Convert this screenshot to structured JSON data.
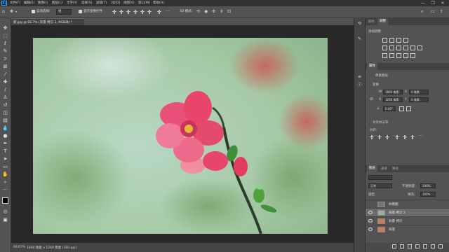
{
  "menubar": {
    "app_icon": "Ps",
    "items": [
      "文件(F)",
      "编辑(E)",
      "图像(I)",
      "图层(L)",
      "文字(Y)",
      "选择(S)",
      "滤镜(T)",
      "3D(D)",
      "视图(V)",
      "窗口(W)",
      "帮助(H)"
    ],
    "window_controls": [
      "—",
      "❐",
      "✕"
    ]
  },
  "options": {
    "auto_select_label": "自动选择:",
    "auto_select_value": "组",
    "transform_label": "显示变换控件",
    "mode_3d_label": "3D 模式:"
  },
  "tab": {
    "title": "新.jpg @ 66.7% (背景 拷贝 2, RGB/8) *"
  },
  "status": {
    "zoom": "66.67%",
    "info": "1890 像素 x 1260 像素 (300 ppi)"
  },
  "panels": {
    "top_tabs": [
      "颜色",
      "调整"
    ],
    "adjust_title": "添加调整",
    "props_tab": "属性",
    "props_type": "像素图层",
    "transform_label": "变换",
    "w_label": "W",
    "w_value": "1890 像素",
    "h_label": "H",
    "h_value": "1260 像素",
    "x_label": "X",
    "x_value": "0 像素",
    "y_label": "Y",
    "y_value": "0 像素",
    "angle_value": "0.00°",
    "align_label": "对齐并分布",
    "align_sub": "对齐:",
    "layer_tabs": [
      "图层",
      "通道",
      "路径"
    ],
    "blend_mode": "正常",
    "opacity_label": "不透明度:",
    "opacity_value": "100%",
    "lock_label": "锁定:",
    "fill_label": "填充:",
    "fill_value": "100%",
    "layers": [
      {
        "name": "你看图",
        "visible": false,
        "selected": false
      },
      {
        "name": "背景 拷贝 2",
        "visible": true,
        "selected": true
      },
      {
        "name": "背景 拷贝",
        "visible": true,
        "selected": false
      },
      {
        "name": "背景",
        "visible": true,
        "selected": false
      }
    ]
  },
  "colors": {
    "accent": "#31a8ff",
    "flower": "#e8456a"
  }
}
